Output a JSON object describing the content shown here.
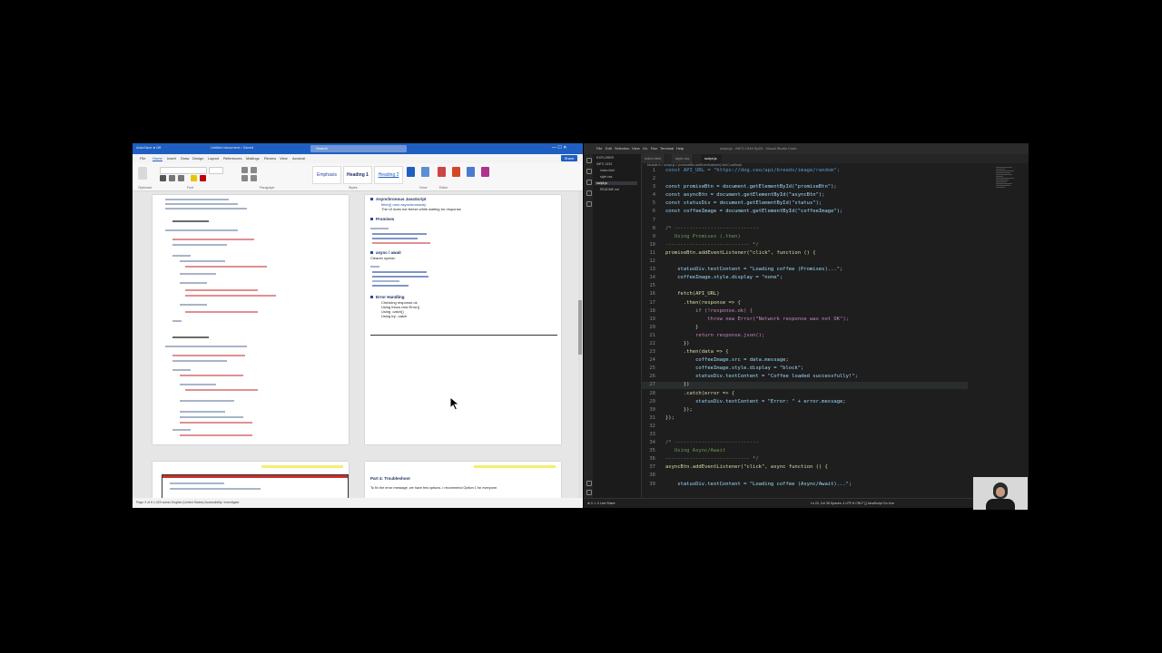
{
  "word": {
    "qa_text": "AutoSave  ● Off",
    "doc_title": "Untitled document • Saved",
    "search_placeholder": "Search",
    "win_controls": "—  ☐  ✕",
    "tabs": [
      "File",
      "Home",
      "Insert",
      "Draw",
      "Design",
      "Layout",
      "References",
      "Mailings",
      "Review",
      "View",
      "Acrobat"
    ],
    "share_label": "Share",
    "ribbon_groups": [
      "Clipboard",
      "Font",
      "Paragraph",
      "Styles",
      "Voice",
      "Editor"
    ],
    "styles": [
      "Emphasis",
      "Heading 1",
      "Heading 2"
    ],
    "page2": {
      "h_async": "Asynchronous JavaScript",
      "b1": "fetch() runs asynchronously",
      "b2": "The UI does not freeze while waiting for response",
      "h_promises": "Promises",
      "h_await": "async / await",
      "cleaner": "Cleaner syntax:",
      "h_errors": "Error Handling",
      "e1": "Checking response.ok",
      "e2": "Using throw new Error()",
      "e3": "Using .catch()",
      "e4": "Using try...catch"
    },
    "page4": {
      "h": "Part 4: Troubleshoot",
      "t": "To fix the error message, we have few options. I recommend Option 1 for everyone."
    },
    "status": "Page 3 of 6   1,020 words   English (United States)   Accessibility: Investigate"
  },
  "vscode": {
    "menu": [
      "File",
      "Edit",
      "Selection",
      "View",
      "Go",
      "Run",
      "Terminal",
      "Help"
    ],
    "window_title": "script.js - INFO 1334 Sp25 - Visual Studio Code",
    "explorer_items": [
      "EXPLORER",
      "INFO 1334",
      "index.html",
      "style.css",
      "script.js",
      "README.md"
    ],
    "tabs": [
      "index.html",
      "style.css",
      "script.js"
    ],
    "breadcrumbs": "Module 6 > script.js > promiseBtn.addEventListener('click') callback",
    "code": {
      "l1": "const API_URL = \"https://dog.ceo/api/breeds/image/random\";",
      "l3": "const promiseBtn = document.getElementById(\"promiseBtn\");",
      "l4": "const asyncBtn = document.getElementById(\"asyncBtn\");",
      "l5": "const statusDiv = document.getElementById(\"status\");",
      "l6": "const coffeeImage = document.getElementById(\"coffeeImage\");",
      "l8": "/* ----------------------------",
      "l9": "   Using Promises (.then)",
      "l10": "---------------------------- */",
      "l11": "promiseBtn.addEventListener(\"click\", function () {",
      "l13": "    statusDiv.textContent = \"Loading coffee (Promises)...\";",
      "l14": "    coffeeImage.style.display = \"none\";",
      "l16": "    fetch(API_URL)",
      "l17": "      .then(response => {",
      "l18": "          if (!response.ok) {",
      "l19": "              throw new Error(\"Network response was not OK\");",
      "l20": "          }",
      "l21": "          return response.json();",
      "l22": "      })",
      "l23": "      .then(data => {",
      "l24": "          coffeeImage.src = data.message;",
      "l25": "          coffeeImage.style.display = \"block\";",
      "l26": "          statusDiv.textContent = \"Coffee loaded successfully!\";",
      "l27": "      })",
      "l28": "      .catch(error => {",
      "l29": "          statusDiv.textContent = \"Error: \" + error.message;",
      "l30": "      });",
      "l31": "});",
      "l34": "/* ----------------------------",
      "l35": "   Using Async/Await",
      "l36": "---------------------------- */",
      "l37": "asyncBtn.addEventListener(\"click\", async function () {",
      "l39": "    statusDiv.textContent = \"Loading coffee (Async/Await)...\";"
    },
    "status_left": "⊗ 0  ⚠ 0   Live Share",
    "status_right": "Ln 24, Col 38   Spaces: 4   UTF-8   CRLF   {} JavaScript   Go Live"
  }
}
